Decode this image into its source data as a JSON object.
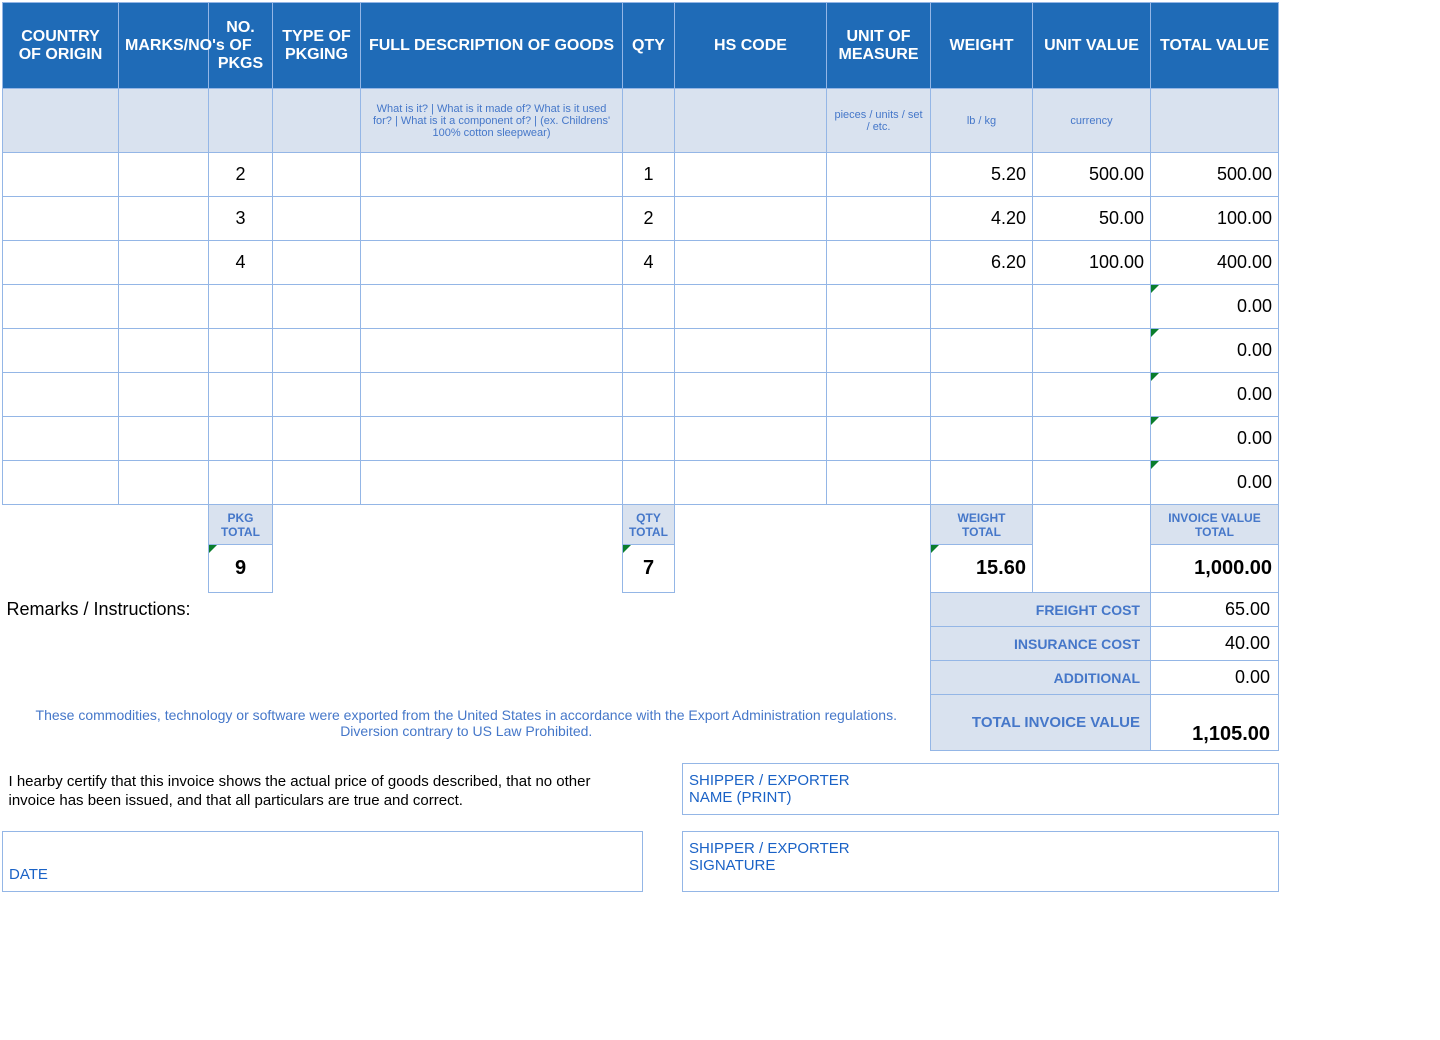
{
  "headers": [
    "COUNTRY OF ORIGIN",
    "MARKS/NO's",
    "NO. OF PKGS",
    "TYPE OF PKGING",
    "FULL DESCRIPTION OF GOODS",
    "QTY",
    "HS CODE",
    "UNIT OF MEASURE",
    "WEIGHT",
    "UNIT VALUE",
    "TOTAL VALUE"
  ],
  "hints": {
    "desc": "What is it? | What is it made of? What is it used for? | What is it a component of? | (ex. Childrens' 100% cotton sleepwear)",
    "uom": "pieces / units / set / etc.",
    "weight": "lb / kg",
    "unitvalue": "currency"
  },
  "rows": [
    {
      "pkgs": "2",
      "qty": "1",
      "weight": "5.20",
      "unitval": "500.00",
      "total": "500.00"
    },
    {
      "pkgs": "3",
      "qty": "2",
      "weight": "4.20",
      "unitval": "50.00",
      "total": "100.00"
    },
    {
      "pkgs": "4",
      "qty": "4",
      "weight": "6.20",
      "unitval": "100.00",
      "total": "400.00"
    },
    {
      "pkgs": "",
      "qty": "",
      "weight": "",
      "unitval": "",
      "total": "0.00"
    },
    {
      "pkgs": "",
      "qty": "",
      "weight": "",
      "unitval": "",
      "total": "0.00"
    },
    {
      "pkgs": "",
      "qty": "",
      "weight": "",
      "unitval": "",
      "total": "0.00"
    },
    {
      "pkgs": "",
      "qty": "",
      "weight": "",
      "unitval": "",
      "total": "0.00"
    },
    {
      "pkgs": "",
      "qty": "",
      "weight": "",
      "unitval": "",
      "total": "0.00"
    }
  ],
  "totals": {
    "pkg_label": "PKG TOTAL",
    "pkg": "9",
    "qty_label": "QTY TOTAL",
    "qty": "7",
    "weight_label": "WEIGHT TOTAL",
    "weight": "15.60",
    "invoice_label": "INVOICE VALUE TOTAL",
    "invoice": "1,000.00"
  },
  "costs": {
    "freight_label": "FREIGHT COST",
    "freight": "65.00",
    "insurance_label": "INSURANCE COST",
    "insurance": "40.00",
    "additional_label": "ADDITIONAL",
    "additional": "0.00",
    "total_label": "TOTAL INVOICE VALUE",
    "total": "1,105.00"
  },
  "text": {
    "remarks": "Remarks / Instructions:",
    "export": "These commodities, technology or software were exported from the United States in accordance with the Export Administration regulations.  Diversion contrary to US Law Prohibited.",
    "cert": "I hearby certify that this invoice shows the actual price of goods described, that no other invoice has been issued, and that all particulars are true and correct.",
    "date": "DATE",
    "sig1a": "SHIPPER / EXPORTER",
    "sig1b": "NAME (PRINT)",
    "sig2a": "SHIPPER / EXPORTER",
    "sig2b": "SIGNATURE"
  }
}
